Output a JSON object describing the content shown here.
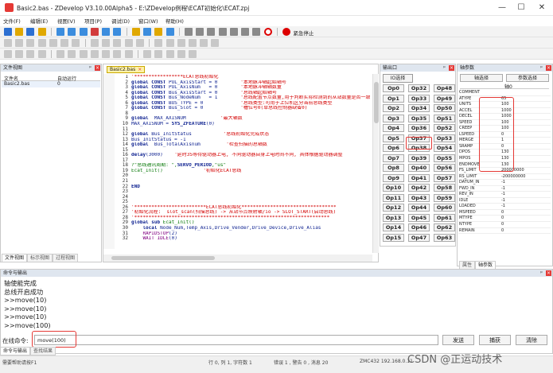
{
  "window": {
    "title": "Basic2.bas - ZDevelop V3.10.00Alpha5 - E:\\ZDevelop例程\\ECAT初始化\\ECAT.zpj",
    "minimize": "—",
    "maximize": "☐",
    "close": "✕"
  },
  "menu": [
    "文件(F)",
    "编辑(E)",
    "视图(V)",
    "项目(P)",
    "调试(D)",
    "窗口(W)",
    "帮助(H)"
  ],
  "toolbar": {
    "emergency_stop": "紧急停止"
  },
  "file_panel": {
    "title": "文件视图",
    "col_name": "文件名",
    "col_autorun": "自动运行",
    "files": [
      {
        "name": "Basic2.bas",
        "autorun": "0"
      }
    ],
    "tabs": [
      "文件视图",
      "标示视图",
      "过程视图"
    ]
  },
  "editor": {
    "tab": "Basic2.bas",
    "tab_close": "×",
    "lines": [
      {
        "n": "1",
        "segs": [
          [
            "cm",
            "'*****************ECAT总线初始化"
          ]
        ]
      },
      {
        "n": "2",
        "segs": [
          [
            "kw",
            "global CONST "
          ],
          [
            "nm",
            "PUL_AxisStart = 0        "
          ],
          [
            "cm",
            "'本地脉冲轴起始轴号"
          ]
        ]
      },
      {
        "n": "3",
        "segs": [
          [
            "kw",
            "global CONST "
          ],
          [
            "nm",
            "PUL_AxisNum   = 0        "
          ],
          [
            "cm",
            "'本地脉冲轴轴数量"
          ]
        ]
      },
      {
        "n": "4",
        "segs": [
          [
            "kw",
            "global CONST "
          ],
          [
            "nm",
            "Bus_AxisStart = 0        "
          ],
          [
            "cm",
            "'总线轴起始轴号"
          ]
        ]
      },
      {
        "n": "5",
        "segs": [
          [
            "kw",
            "global CONST "
          ],
          [
            "nm",
            "Bus_NodeNum   = 1        "
          ],
          [
            "cm",
            "'总线配置节点数量,用于判断实际检测到的从站数量是否一致"
          ]
        ]
      },
      {
        "n": "6",
        "segs": [
          [
            "kw",
            "global CONST "
          ],
          [
            "nm",
            "BUS_TYPE = 0             "
          ],
          [
            "cm",
            "'总线类型:可用于上位机区分当前总线类型"
          ]
        ]
      },
      {
        "n": "7",
        "segs": [
          [
            "kw",
            "global CONST "
          ],
          [
            "nm",
            "Bus_Slot = 0             "
          ],
          [
            "cm",
            "'槽位号0(单总线控制器缺省0)"
          ]
        ]
      },
      {
        "n": "8",
        "segs": []
      },
      {
        "n": "9",
        "segs": [
          [
            "kw",
            "global "
          ],
          [
            "nm",
            " MAX_AXISNUM            "
          ],
          [
            "cm",
            "'最大轴数"
          ]
        ]
      },
      {
        "n": "10",
        "segs": [
          [
            "nm",
            "MAX_AXISNUM = "
          ],
          [
            "kw",
            "SYS_ZFEATURE"
          ],
          [
            "nm",
            "(0)"
          ]
        ]
      },
      {
        "n": "11",
        "segs": []
      },
      {
        "n": "12",
        "segs": [
          [
            "kw",
            "global "
          ],
          [
            "nm",
            "Bus_InitStatus           "
          ],
          [
            "cm",
            "'总线初始化完成状态"
          ]
        ]
      },
      {
        "n": "13",
        "segs": [
          [
            "nm",
            "Bus_InitStatus = -1"
          ]
        ]
      },
      {
        "n": "14",
        "segs": [
          [
            "kw",
            "global "
          ],
          [
            "nm",
            " Bus_TotalAxisnum         "
          ],
          [
            "cm",
            "'检查扫描的总轴数"
          ]
        ]
      },
      {
        "n": "15",
        "segs": []
      },
      {
        "n": "16",
        "segs": [
          [
            "kw",
            "delay"
          ],
          [
            "nm",
            "(3000)    "
          ],
          [
            "cm",
            "'延时3S等待驱动器上电, 不同驱动器自身上电时间不同, 具体根据驱动器调整"
          ]
        ]
      },
      {
        "n": "17",
        "segs": []
      },
      {
        "n": "18",
        "segs": [
          [
            "fn",
            "?\"总线通讯周期: \","
          ],
          [
            "kw",
            "SERVO_PERIOD"
          ],
          [
            "fn",
            ",\"us\""
          ]
        ]
      },
      {
        "n": "19",
        "segs": [
          [
            "fn",
            "Ecat_Init()              "
          ],
          [
            "cm",
            "'初始化ECAT总线"
          ]
        ]
      },
      {
        "n": "20",
        "segs": []
      },
      {
        "n": "21",
        "segs": []
      },
      {
        "n": "22",
        "segs": [
          [
            "kw",
            "END"
          ]
        ]
      },
      {
        "n": "23",
        "segs": []
      },
      {
        "n": "24",
        "segs": []
      },
      {
        "n": "25",
        "segs": []
      },
      {
        "n": "26",
        "segs": [
          [
            "cm",
            "'*************************ECAT总线初始化*********************************"
          ]
        ]
      },
      {
        "n": "27",
        "segs": [
          [
            "cm",
            "'初始化流程:  slot_scan(扫描总线) -> 从站节点映射轴/io -> SLOT_START(启动总线)"
          ]
        ]
      },
      {
        "n": "28",
        "segs": [
          [
            "cm",
            "'********************************************************************"
          ]
        ]
      },
      {
        "n": "29",
        "segs": [
          [
            "kw",
            "global sub "
          ],
          [
            "fn",
            "Ecat_Init()"
          ]
        ]
      },
      {
        "n": "30",
        "segs": [
          [
            "kw",
            "    local "
          ],
          [
            "nm",
            "Node_Num,Temp_Axis,Drive_Vender,Drive_Device,Drive_Alias"
          ]
        ]
      },
      {
        "n": "31",
        "segs": [
          [
            "pu",
            "    RAPIDSTOP"
          ],
          [
            "nm",
            "(2)"
          ]
        ]
      },
      {
        "n": "32",
        "segs": [
          [
            "pu",
            "    WAIT IDLE"
          ],
          [
            "nm",
            "(0)"
          ]
        ]
      }
    ]
  },
  "port_panel": {
    "title": "输出口",
    "selector": "IO选择",
    "ports": [
      [
        "Op0",
        "Op32",
        "Op48"
      ],
      [
        "Op1",
        "Op33",
        "Op49"
      ],
      [
        "Op2",
        "Op34",
        "Op50"
      ],
      [
        "Op3",
        "Op35",
        "Op51"
      ],
      [
        "Op4",
        "Op36",
        "Op52"
      ],
      [
        "Op5",
        "Op37",
        "Op53"
      ],
      [
        "Op6",
        "Op38",
        "Op54"
      ],
      [
        "Op7",
        "Op39",
        "Op55"
      ],
      [
        "Op8",
        "Op40",
        "Op56"
      ],
      [
        "Op9",
        "Op41",
        "Op57"
      ],
      [
        "Op10",
        "Op42",
        "Op58"
      ],
      [
        "Op11",
        "Op43",
        "Op59"
      ],
      [
        "Op12",
        "Op44",
        "Op60"
      ],
      [
        "Op13",
        "Op45",
        "Op61"
      ],
      [
        "Op14",
        "Op46",
        "Op62"
      ],
      [
        "Op15",
        "Op47",
        "Op63"
      ]
    ]
  },
  "param_panel": {
    "title": "轴参数",
    "tab_axis": "轴选择",
    "tab_params": "参数选择",
    "axis_header": "轴0",
    "params": [
      [
        "COMMENT",
        ""
      ],
      [
        "ATYPE",
        "65"
      ],
      [
        "UNITS",
        "100"
      ],
      [
        "ACCEL",
        "1000"
      ],
      [
        "DECEL",
        "1000"
      ],
      [
        "SPEED",
        "100"
      ],
      [
        "CREEP",
        "100"
      ],
      [
        "LSPEED",
        "0"
      ],
      [
        "MERGE",
        "1"
      ],
      [
        "SRAMP",
        "0"
      ],
      [
        "DPOS",
        "130"
      ],
      [
        "MPOS",
        "130"
      ],
      [
        "ENDMOVE",
        "130"
      ],
      [
        "FS_LIMIT",
        "200000000"
      ],
      [
        "RS_LIMIT",
        "-200000000"
      ],
      [
        "DATUM_IN",
        "-1"
      ],
      [
        "FWD_IN",
        "-1"
      ],
      [
        "REV_IN",
        "-1"
      ],
      [
        "IDLE",
        "-1"
      ],
      [
        "LOADED",
        "-1"
      ],
      [
        "MSPEED",
        "0"
      ],
      [
        "MTYPE",
        "0"
      ],
      [
        "NTYPE",
        "0"
      ],
      [
        "REMAIN",
        "0"
      ]
    ],
    "bottom_tabs": [
      "属性",
      "轴参数"
    ]
  },
  "cmd_panel": {
    "title": "命令与输出",
    "output": [
      "轴使能完成",
      "总线开启成功",
      ">>move(10)",
      ">>move(10)",
      ">>move(10)",
      ">>move(100)"
    ],
    "input_label": "在线命令:",
    "input_value": "move(100)",
    "send": "发送",
    "capture": "捕获",
    "clear": "清除",
    "tabs": [
      "命令与输出",
      "查找结果"
    ]
  },
  "status": {
    "help": "需要帮助请按F1",
    "position": "行 0, 列 1, 字符数 1",
    "connection": "ZMC432 192.168.0.11",
    "extra": "错误 1 , 警告 0 , 消息 20"
  },
  "watermark": "CSDN @正运动技术"
}
